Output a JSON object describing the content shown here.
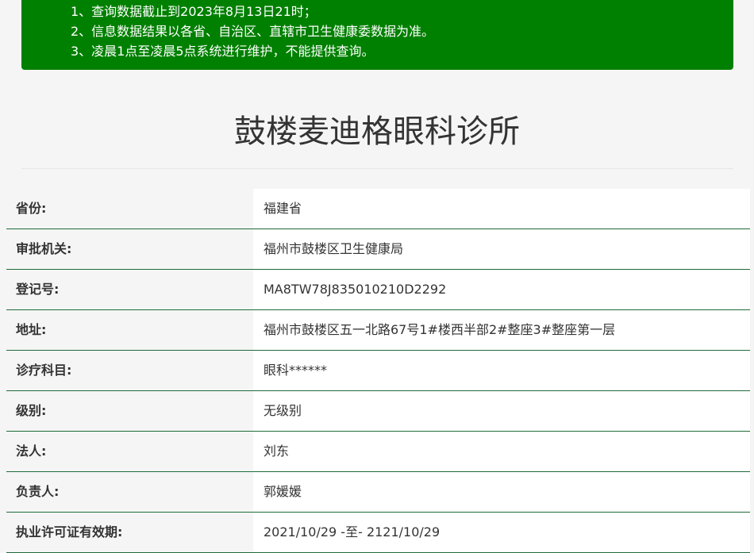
{
  "notice": {
    "lines": [
      "1、查询数据截止到2023年8月13日21时；",
      "2、信息数据结果以各省、自治区、直辖市卫生健康委数据为准。",
      "3、凌晨1点至凌晨5点系统进行维护，不能提供查询。"
    ],
    "background_color": "#008000"
  },
  "title": "鼓楼麦迪格眼科诊所",
  "details": [
    {
      "label": "省份:",
      "value": "福建省"
    },
    {
      "label": "审批机关:",
      "value": "福州市鼓楼区卫生健康局"
    },
    {
      "label": "登记号:",
      "value": "MA8TW78J835010210D2292"
    },
    {
      "label": "地址:",
      "value": "福州市鼓楼区五一北路67号1#楼西半部2#整座3#整座第一层"
    },
    {
      "label": "诊疗科目:",
      "value": "眼科******"
    },
    {
      "label": "级别:",
      "value": "无级别"
    },
    {
      "label": "法人:",
      "value": "刘东"
    },
    {
      "label": "负责人:",
      "value": "郭媛媛"
    },
    {
      "label": "执业许可证有效期:",
      "value": "2021/10/29 -至- 2121/10/29"
    }
  ],
  "row_border_color": "#1f6b3a"
}
